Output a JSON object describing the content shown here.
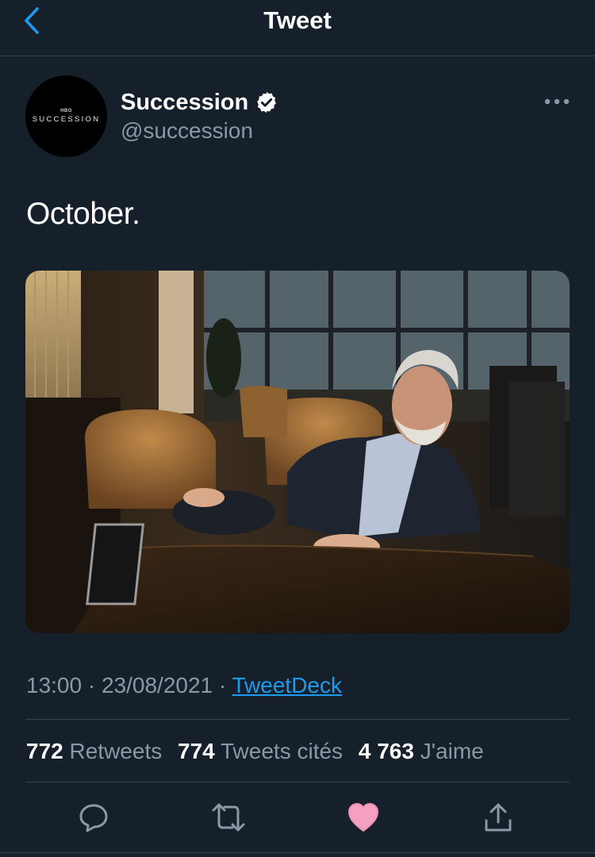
{
  "header": {
    "title": "Tweet"
  },
  "author": {
    "display_name": "Succession",
    "handle": "@succession",
    "avatar": {
      "network_mark": "HBO",
      "wordmark": "SUCCESSION"
    },
    "verified": true
  },
  "tweet": {
    "text": "October.",
    "time": "13:00",
    "date": "23/08/2021",
    "source": "TweetDeck"
  },
  "stats": {
    "retweets": {
      "count": "772",
      "label": "Retweets"
    },
    "quotes": {
      "count": "774",
      "label": "Tweets cités"
    },
    "likes": {
      "count": "4 763",
      "label": "J'aime"
    }
  },
  "actions": [
    "reply-icon",
    "retweet-icon",
    "like-icon",
    "share-icon"
  ],
  "colors": {
    "background": "#15202b",
    "accent": "#1d9bf0",
    "secondary_text": "#8b98a5",
    "divider": "#38444d",
    "like": "#f91880"
  }
}
